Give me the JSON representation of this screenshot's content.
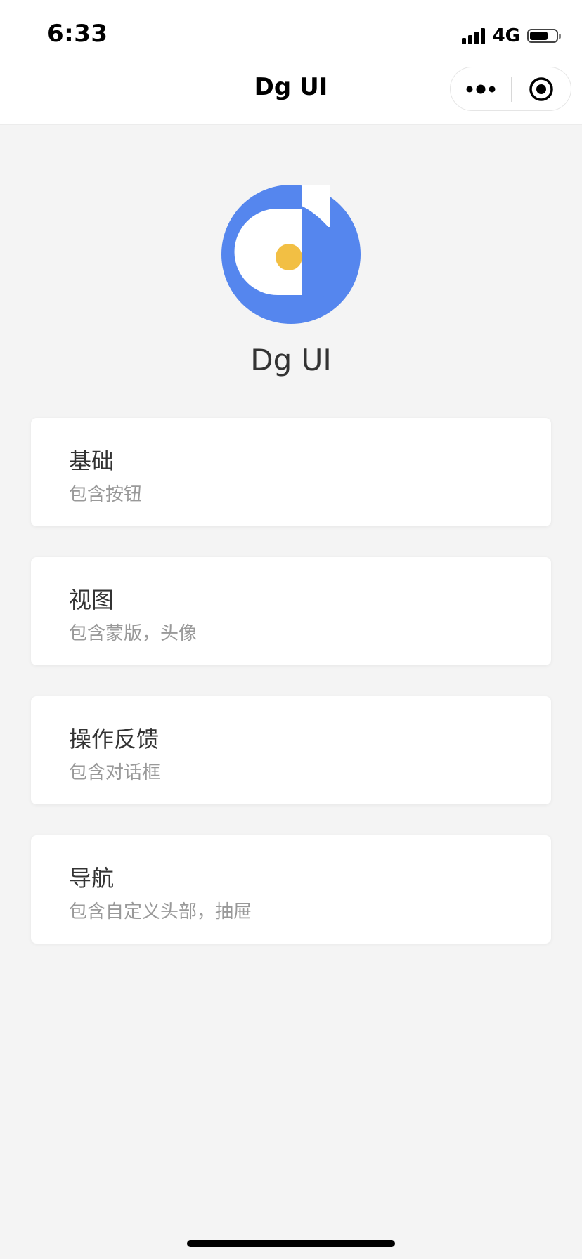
{
  "status_bar": {
    "time": "6:33",
    "network": "4G",
    "battery_level": 0.7
  },
  "nav": {
    "title": "Dg UI",
    "more_icon": "more-dots-icon",
    "close_icon": "target-circle-icon"
  },
  "brand": {
    "name": "Dg UI",
    "colors": {
      "primary": "#5586ee",
      "accent": "#f2bf44"
    }
  },
  "menu": [
    {
      "title": "基础",
      "desc": "包含按钮"
    },
    {
      "title": "视图",
      "desc": "包含蒙版，头像"
    },
    {
      "title": "操作反馈",
      "desc": "包含对话框"
    },
    {
      "title": "导航",
      "desc": "包含自定义头部，抽屉"
    }
  ]
}
